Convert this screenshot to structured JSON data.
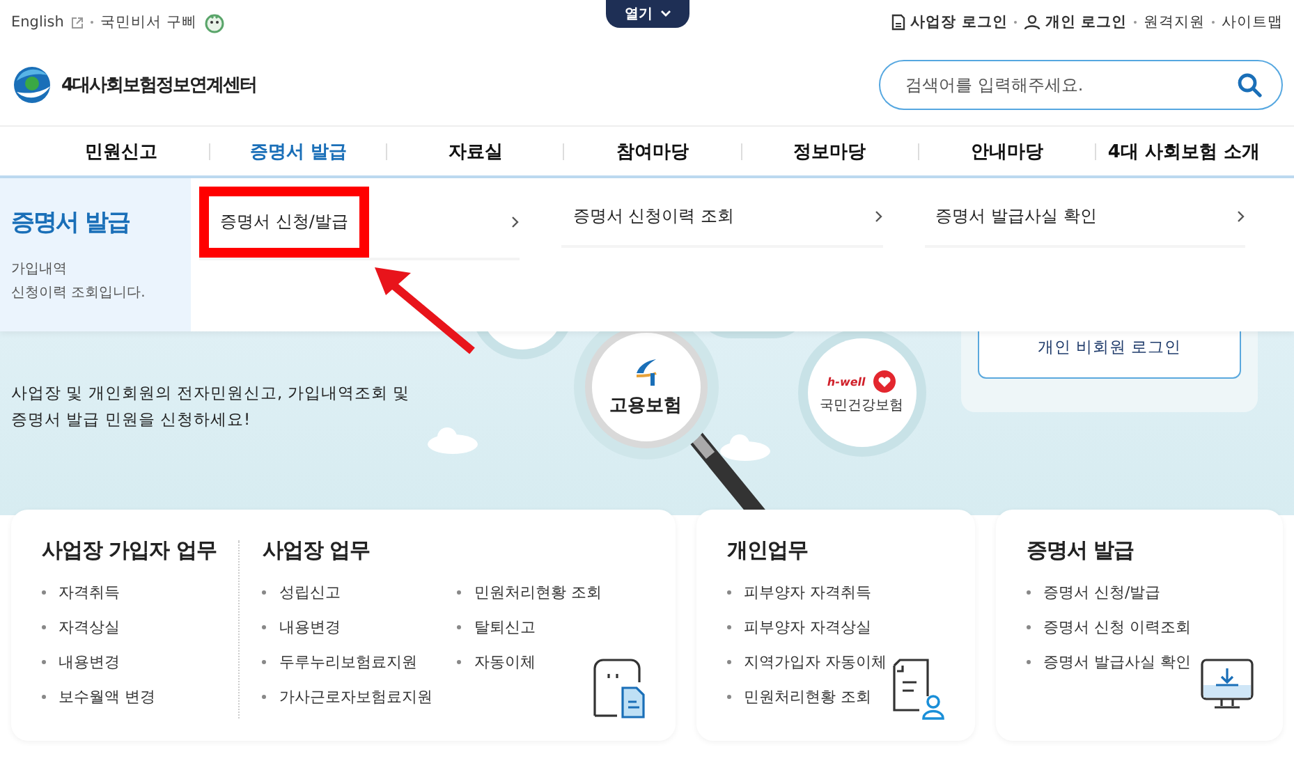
{
  "top_bar": {
    "left_links": [
      "English",
      "국민비서 구삐"
    ],
    "toggle": {
      "label": "열기",
      "expanded": false
    },
    "right_links": [
      {
        "kind": "business",
        "label": "사업장 로그인"
      },
      {
        "kind": "person",
        "label": "개인 로그인"
      },
      {
        "kind": "plain",
        "label": "원격지원"
      },
      {
        "kind": "plain",
        "label": "사이트맵"
      }
    ]
  },
  "header": {
    "site_title": "4대사회보험정보연계센터",
    "search": {
      "placeholder": "검색어를 입력해주세요."
    }
  },
  "nav": [
    {
      "label": "민원신고",
      "selected": false
    },
    {
      "label": "증명서 발급",
      "selected": true
    },
    {
      "label": "자료실",
      "selected": false
    },
    {
      "label": "참여마당",
      "selected": false
    },
    {
      "label": "정보마당",
      "selected": false
    },
    {
      "label": "안내마당",
      "selected": false
    },
    {
      "label": "4대 사회보험 소개",
      "selected": false
    }
  ],
  "dropdown": {
    "title": "증명서 발급",
    "description": [
      "가입내역",
      "신청이력 조회입니다."
    ],
    "items": [
      {
        "label": "증명서 신청/발급",
        "highlighted": true
      },
      {
        "label": "증명서 신청이력 조회",
        "highlighted": false
      },
      {
        "label": "증명서 발급사실 확인",
        "highlighted": false
      }
    ]
  },
  "hero": {
    "subtitle": [
      "사업장 및 개인회원의 전자민원신고, 가입내역조회 및",
      "증명서 발급 민원을 신청하세요!"
    ],
    "badges": [
      {
        "kind": "employment",
        "label": "고용보험"
      },
      {
        "kind": "health",
        "label": "국민건강보험",
        "tag": "h-well"
      }
    ],
    "login_button": "개인 비회원 로그인"
  },
  "cards": [
    {
      "sections": [
        {
          "title": "사업장 가입자 업무",
          "columns": [
            [
              "자격취득",
              "자격상실",
              "내용변경",
              "보수월액 변경"
            ]
          ]
        },
        {
          "title": "사업장 업무",
          "columns": [
            [
              "성립신고",
              "내용변경",
              "두루누리보험료지원",
              "가사근로자보험료지원"
            ],
            [
              "민원처리현황 조회",
              "탈퇴신고",
              "자동이체"
            ]
          ]
        }
      ]
    },
    {
      "sections": [
        {
          "title": "개인업무",
          "columns": [
            [
              "피부양자 자격취득",
              "피부양자 자격상실",
              "지역가입자 자동이체",
              "민원처리현황 조회"
            ]
          ]
        }
      ]
    },
    {
      "sections": [
        {
          "title": "증명서 발급",
          "columns": [
            [
              "증명서 신청/발급",
              "증명서 신청 이력조회",
              "증명서 발급사실 확인"
            ]
          ]
        }
      ]
    }
  ]
}
